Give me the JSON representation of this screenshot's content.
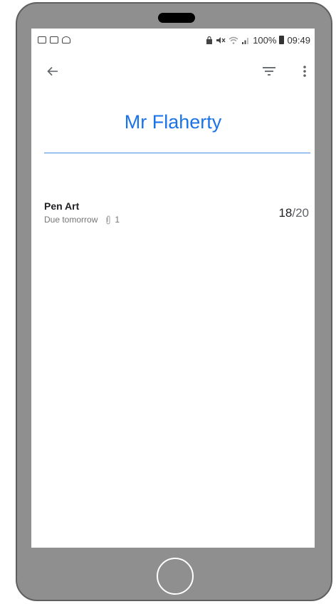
{
  "status_bar": {
    "left_icons": [
      "mail-icon",
      "image-icon",
      "app-icon"
    ],
    "right_icons": [
      "lock-icon",
      "mute-icon",
      "wifi-icon",
      "signal-icon"
    ],
    "battery": "100%",
    "time": "09:49"
  },
  "toolbar": {
    "back_icon": "arrow-back-icon",
    "filter_icon": "filter-icon",
    "more_icon": "more-vert-icon"
  },
  "page": {
    "title": "Mr Flaherty"
  },
  "assignments": [
    {
      "title": "Pen Art",
      "due": "Due tomorrow",
      "attachments": "1",
      "grade": "18",
      "grade_total": "/20"
    }
  ],
  "colors": {
    "accent": "#1a73e8",
    "phone_body": "#8f8f8f"
  }
}
